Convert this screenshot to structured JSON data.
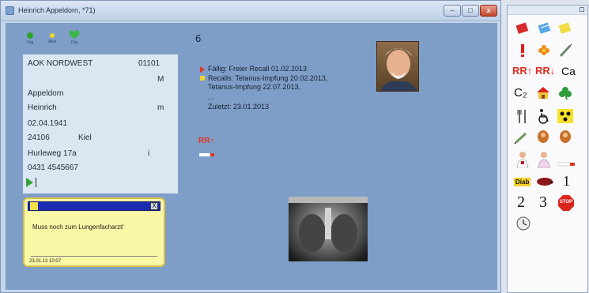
{
  "window": {
    "title": "Heinrich Appeldorn, *71)",
    "min_label": "–",
    "max_label": "□",
    "close_label": "x"
  },
  "status_icons": [
    {
      "label": "Org",
      "icon": "green-dot-icon"
    },
    {
      "label": "Akut",
      "icon": "yellow-dot-icon"
    },
    {
      "label": "Org",
      "icon": "green-heart-icon"
    }
  ],
  "patient": {
    "insurance": "AOK NORDWEST",
    "insurance_number": "01101",
    "status_code": "M",
    "last_name": "Appeldorn",
    "first_name": "Heinrich",
    "gender": "m",
    "birth_date": "02.04.1941",
    "postal_code": "24106",
    "city": "Kiel",
    "street": "Hurleweg 17a",
    "street_flag": "i",
    "phone": "0431 4545667"
  },
  "note": {
    "text": "Muss noch zum Lungenfacharzt!",
    "close_label": "X",
    "date": "23.01.13 10:07"
  },
  "counter": "6",
  "recall": {
    "due": "Fällig: Freier Recall 01.02.2013",
    "recalls_line1": "Recalls: Tetanus-Impfung 20.02.2013,",
    "recalls_line2": "Tetanus-Impfung 22.07.2013,",
    "separator": "...",
    "last": "Zuletzt: 23.01.2013"
  },
  "rr_label": "RR↑",
  "panel_labels": {
    "rr_up": "RR↑",
    "rr_down": "RR↓",
    "ca": "Ca",
    "c2": "C₂",
    "diab": "Diab",
    "one": "1",
    "two": "2",
    "three": "3",
    "stop": "STOP"
  }
}
